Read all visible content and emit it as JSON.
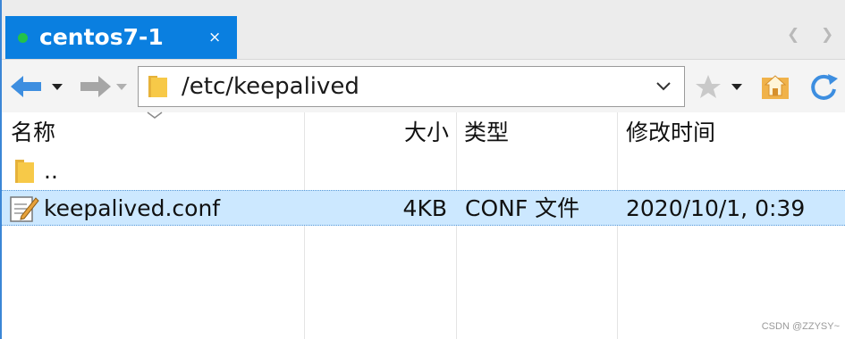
{
  "tab": {
    "title": "centos7-1",
    "close": "×",
    "status_color": "#23c24a",
    "active_color": "#0a7fe0"
  },
  "tab_nav": {
    "prev": "❮",
    "next": "❯"
  },
  "address": {
    "path": "/etc/keepalived"
  },
  "columns": {
    "name": "名称",
    "size": "大小",
    "type": "类型",
    "modified": "修改时间"
  },
  "files": [
    {
      "name": "..",
      "size": "",
      "type": "",
      "modified": "",
      "icon": "folder-icon",
      "selected": false
    },
    {
      "name": "keepalived.conf",
      "size": "4KB",
      "type": "CONF 文件",
      "modified": "2020/10/1, 0:39",
      "icon": "text-file-icon",
      "selected": true
    }
  ],
  "watermark": "CSDN @ZZYSY~"
}
